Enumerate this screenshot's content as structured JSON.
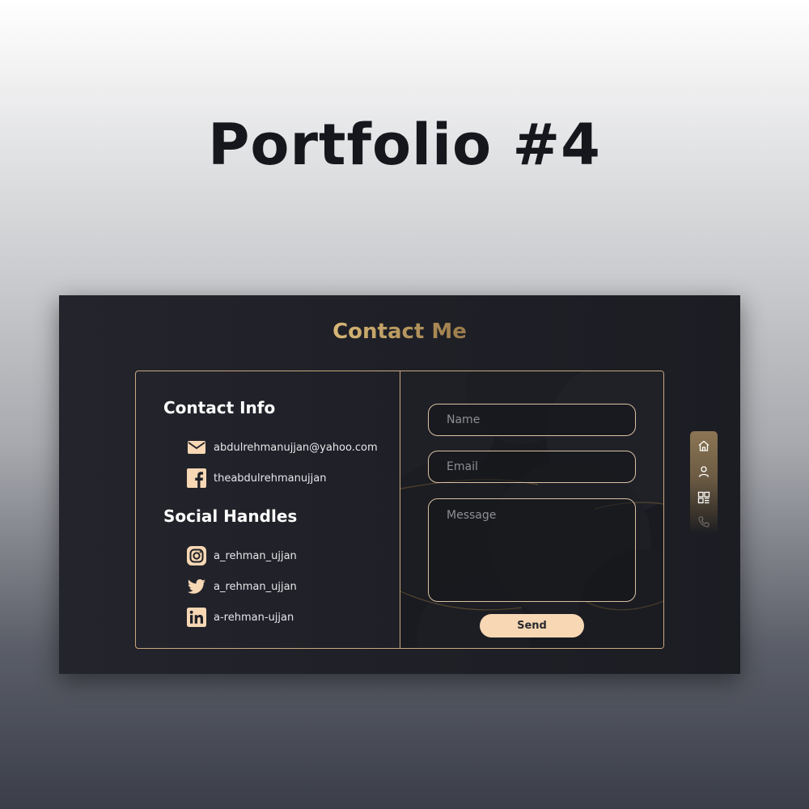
{
  "page": {
    "title": "Portfolio #4"
  },
  "contact": {
    "heading": "Contact Me",
    "info_title": "Contact Info",
    "info": [
      {
        "icon": "mail-icon",
        "text": "abdulrehmanujjan@yahoo.com"
      },
      {
        "icon": "facebook-icon",
        "text": "theabdulrehmanujjan"
      }
    ],
    "social_title": "Social Handles",
    "social": [
      {
        "icon": "instagram-icon",
        "text": "a_rehman_ujjan"
      },
      {
        "icon": "twitter-icon",
        "text": "a_rehman_ujjan"
      },
      {
        "icon": "linkedin-icon",
        "text": "a-rehman-ujjan"
      }
    ]
  },
  "form": {
    "name_placeholder": "Name",
    "email_placeholder": "Email",
    "message_placeholder": "Message",
    "send_label": "Send"
  },
  "nav": {
    "items": [
      "home-icon",
      "user-icon",
      "grid-icon",
      "phone-icon"
    ]
  },
  "colors": {
    "accent_gold": "#c9a46a",
    "border": "#c9a77f",
    "button_bg": "#f7d7b4",
    "frame_bg": "#1f2027"
  }
}
